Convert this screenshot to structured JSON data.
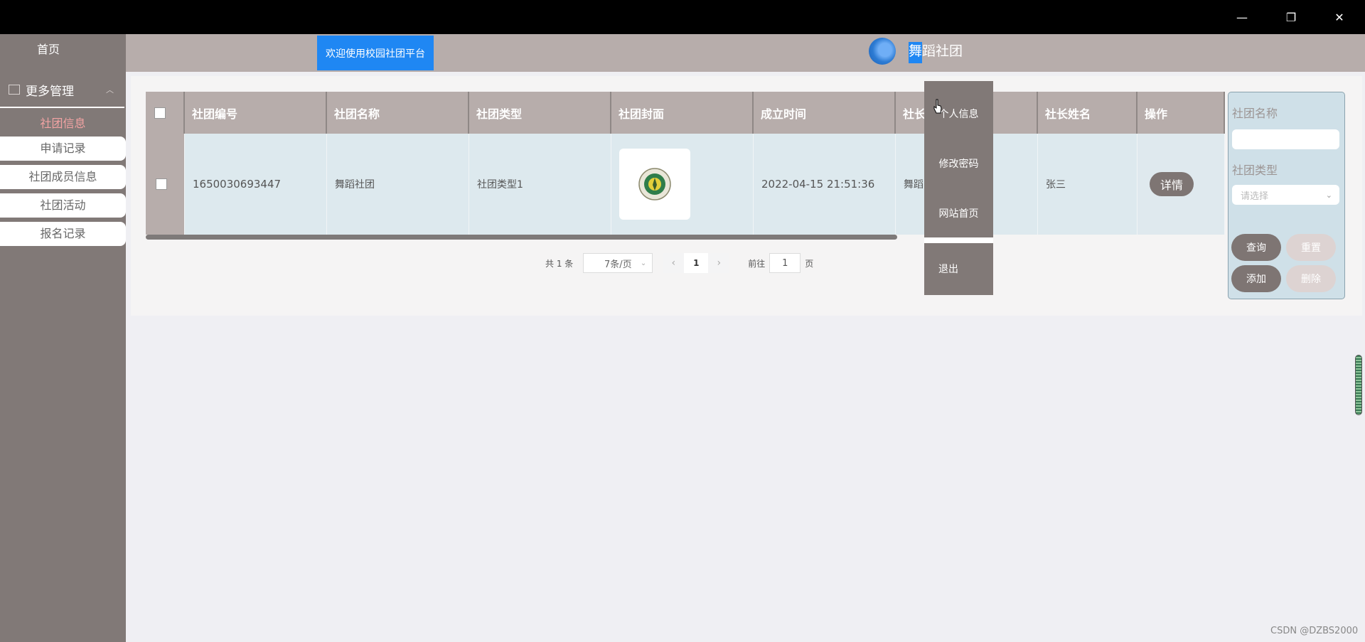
{
  "window": {
    "minimize": "—",
    "restore": "❐",
    "close": "✕"
  },
  "sidebar": {
    "home": "首页",
    "group_label": "更多管理",
    "active_item": "社团信息",
    "items": [
      "申请记录",
      "社团成员信息",
      "社团活动",
      "报名记录"
    ]
  },
  "header": {
    "welcome": "欢迎使用校园社团平台",
    "user_first_char": "舞",
    "user_rest": "蹈社团"
  },
  "table": {
    "columns": [
      "社团编号",
      "社团名称",
      "社团类型",
      "社团封面",
      "成立时间",
      "社长",
      "",
      "社长姓名",
      "操作"
    ],
    "rows": [
      {
        "id": "1650030693447",
        "name": "舞蹈社团",
        "type": "社团类型1",
        "created": "2022-04-15 21:51:36",
        "leader_account": "舞蹈",
        "leader_name": "张三",
        "action": "详情"
      }
    ]
  },
  "pagination": {
    "total": "共 1 条",
    "page_size": "7条/页",
    "current_page": "1",
    "goto_prefix": "前往",
    "goto_value": "1",
    "goto_suffix": "页"
  },
  "user_menu": {
    "items": [
      "个人信息",
      "修改密码",
      "网站首页",
      "退出"
    ]
  },
  "search_panel": {
    "name_label": "社团名称",
    "name_value": "",
    "type_label": "社团类型",
    "type_placeholder": "请选择",
    "query_btn": "查询",
    "reset_btn": "重置",
    "add_btn": "添加",
    "delete_btn": "删除"
  },
  "watermark": "CSDN @DZBS2000",
  "colors": {
    "header": "#b7adab",
    "sidebar": "#817977",
    "accent_blue": "#1f87f3",
    "active_menu": "#f3a3a3"
  }
}
